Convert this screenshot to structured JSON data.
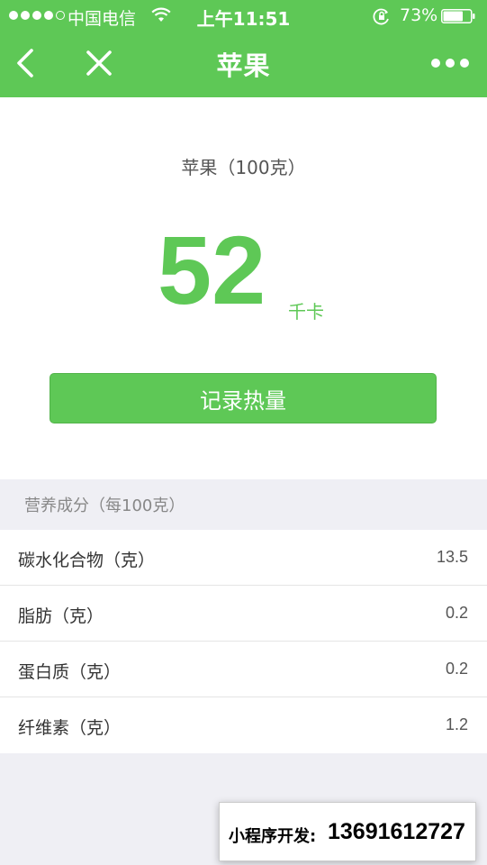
{
  "status_bar": {
    "carrier": "中国电信",
    "time": "上午11:51",
    "battery_percent": "73%",
    "battery_level": 0.73,
    "signal_bars": 4
  },
  "nav": {
    "title": "苹果",
    "back_icon": "chevron-left-icon",
    "close_icon": "close-icon",
    "more_icon": "more-dots-icon"
  },
  "food": {
    "name": "苹果（100克）",
    "calories": "52",
    "calorie_unit": "千卡",
    "record_button_label": "记录热量"
  },
  "nutrition": {
    "section_title": "营养成分（每100克）",
    "items": [
      {
        "label": "碳水化合物（克）",
        "value": "13.5"
      },
      {
        "label": "脂肪（克）",
        "value": "0.2"
      },
      {
        "label": "蛋白质（克）",
        "value": "0.2"
      },
      {
        "label": "纤维素（克）",
        "value": "1.2"
      }
    ]
  },
  "promo": {
    "label": "小程序开发:",
    "phone": "13691612727"
  },
  "colors": {
    "brand_green": "#5ec856",
    "background_gray": "#efeff4"
  }
}
